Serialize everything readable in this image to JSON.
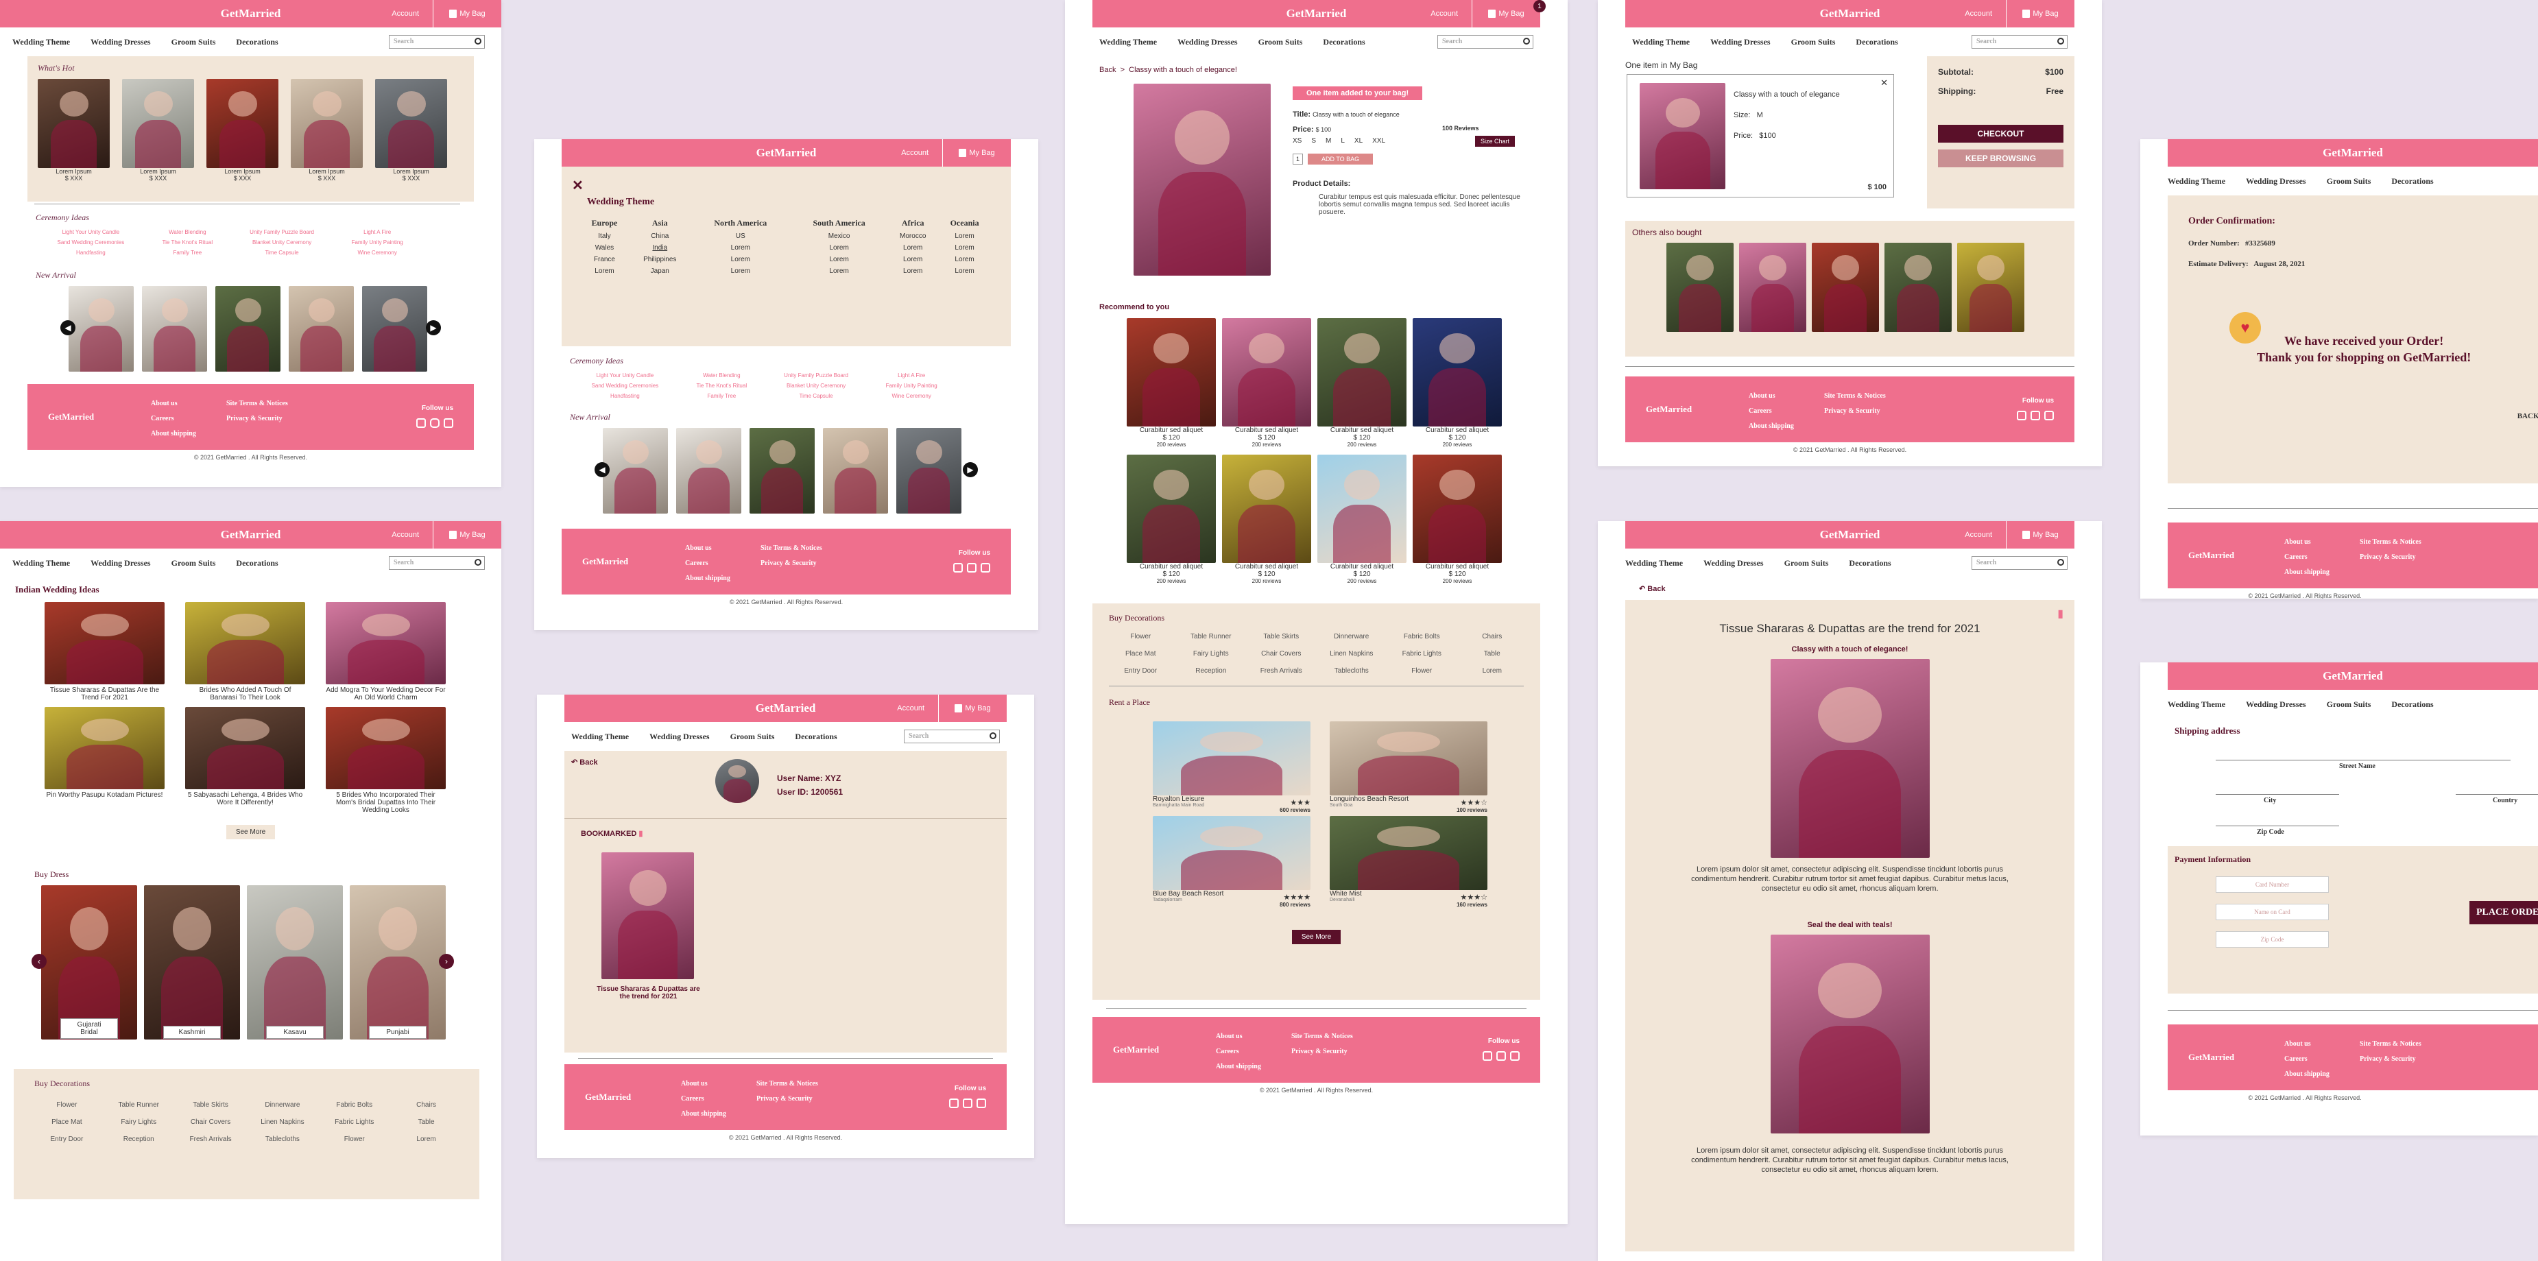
{
  "brand": "GetMarried",
  "account": "Account",
  "my_bag": "My Bag",
  "bag_count": "1",
  "nav": [
    "Wedding Theme",
    "Wedding Dresses",
    "Groom Suits",
    "Decorations"
  ],
  "search_placeholder": "Search",
  "footer": {
    "about": "About us",
    "careers": "Careers",
    "shipping": "About shipping",
    "terms": "Site Terms & Notices",
    "privacy": "Privacy & Security",
    "follow": "Follow us",
    "copyright": "© 2021 GetMarried . All Rights Reserved."
  },
  "home": {
    "whats_hot": "What's Hot",
    "hot_items": [
      {
        "name": "Lorem Ipsum",
        "price": "$ XXX"
      },
      {
        "name": "Lorem Ipsum",
        "price": "$ XXX"
      },
      {
        "name": "Lorem Ipsum",
        "price": "$ XXX"
      },
      {
        "name": "Lorem Ipsum",
        "price": "$ XXX"
      },
      {
        "name": "Lorem Ipsum",
        "price": "$ XXX"
      }
    ],
    "ceremony_ideas": "Ceremony Ideas",
    "ideas": [
      [
        "Light Your Unity Candle",
        "Water Blending",
        "Unity Family Puzzle Board",
        "Light A Fire"
      ],
      [
        "Sand Wedding Ceremonies",
        "Tie The Knot's Ritual",
        "Blanket Unity Ceremony",
        "Family Unity Painting"
      ],
      [
        "Handfasting",
        "Family Tree",
        "Time Capsule",
        "Wine Ceremony"
      ]
    ],
    "new_arrival": "New Arrival"
  },
  "theme": {
    "title": "Wedding Theme",
    "regions": [
      "Europe",
      "Asia",
      "North America",
      "South America",
      "Africa",
      "Oceania"
    ],
    "rows": [
      [
        "Italy",
        "China",
        "US",
        "Mexico",
        "Morocco",
        "Lorem"
      ],
      [
        "Wales",
        "India",
        "Lorem",
        "Lorem",
        "Lorem",
        "Lorem"
      ],
      [
        "France",
        "Philippines",
        "Lorem",
        "Lorem",
        "Lorem",
        "Lorem"
      ],
      [
        "Lorem",
        "Japan",
        "Lorem",
        "Lorem",
        "Lorem",
        "Lorem"
      ]
    ]
  },
  "ideas_page": {
    "title": "Indian Wedding Ideas",
    "articles": [
      "Tissue Shararas & Dupattas Are the Trend For 2021",
      "Brides Who Added A Touch Of Banarasi To Their Look",
      "Add Mogra To Your Wedding Decor For An Old World Charm",
      "Pin Worthy Pasupu Kotadam Pictures!",
      "5 Sabyasachi Lehenga, 4 Brides Who Wore It Differently!",
      "5 Brides Who Incorporated Their Mom's Bridal Dupattas Into Their Wedding Looks"
    ],
    "see_more": "See More",
    "buy_dress": "Buy Dress",
    "dresses": [
      "Gujarati Bridal",
      "Kashmiri",
      "Kasavu",
      "Punjabi"
    ],
    "buy_decorations": "Buy Decorations",
    "decor": [
      "Flower",
      "Table Runner",
      "Table Skirts",
      "Dinnerware",
      "Fabric Bolts",
      "Chairs",
      "Place Mat",
      "Fairy Lights",
      "Chair Covers",
      "Linen Napkins",
      "Fabric Lights",
      "Table",
      "Entry Door",
      "Reception",
      "Fresh Arrivals",
      "Tablecloths",
      "Flower",
      "Lorem"
    ]
  },
  "profile": {
    "back": "Back",
    "user_name_label": "User Name:",
    "user_name": "XYZ",
    "user_id_label": "User ID:",
    "user_id": "1200561",
    "bookmarked": "BOOKMARKED",
    "article": "Tissue Shararas & Dupattas are the trend for 2021"
  },
  "product": {
    "back": "Back",
    "crumb": "Classy with a touch of elegance!",
    "added": "One item added to your bag!",
    "title_label": "Title:",
    "title": "Classy with a touch of elegance",
    "price_label": "Price:",
    "price": "$ 100",
    "reviews": "100 Reviews",
    "sizes": [
      "XS",
      "S",
      "M",
      "L",
      "XL",
      "XXL"
    ],
    "size_chart": "Size Chart",
    "qty": "1",
    "add": "ADD TO BAG",
    "details_label": "Product Details:",
    "details": "Curabitur tempus est quis malesuada efficitur. Donec pellentesque lobortis semut convallis magna tempus sed. Sed laoreet iaculis posuere.",
    "recommend": "Recommend to you",
    "rec_items": [
      {
        "name": "Curabitur sed aliquet",
        "price": "$ 120",
        "reviews": "200 reviews"
      },
      {
        "name": "Curabitur sed aliquet",
        "price": "$ 120",
        "reviews": "200 reviews"
      },
      {
        "name": "Curabitur sed aliquet",
        "price": "$ 120",
        "reviews": "200 reviews"
      },
      {
        "name": "Curabitur sed aliquet",
        "price": "$ 120",
        "reviews": "200 reviews"
      },
      {
        "name": "Curabitur sed aliquet",
        "price": "$ 120",
        "reviews": "200 reviews"
      },
      {
        "name": "Curabitur sed aliquet",
        "price": "$ 120",
        "reviews": "200 reviews"
      },
      {
        "name": "Curabitur sed aliquet",
        "price": "$ 120",
        "reviews": "200 reviews"
      },
      {
        "name": "Curabitur sed aliquet",
        "price": "$ 120",
        "reviews": "200 reviews"
      }
    ],
    "buy_decorations": "Buy Decorations",
    "rent": "Rent a Place",
    "places": [
      {
        "name": "Royalton Leisure",
        "loc": "Bamnighatta Main Road",
        "stars": "★★★",
        "reviews": "600 reviews"
      },
      {
        "name": "Longuinhos Beach Resort",
        "loc": "South Goa",
        "stars": "★★★☆",
        "reviews": "100 reviews"
      },
      {
        "name": "Blue Bay Beach Resort",
        "loc": "Tadaqalorram",
        "stars": "★★★★",
        "reviews": "800 reviews"
      },
      {
        "name": "White Mist",
        "loc": "Devanahalli",
        "stars": "★★★☆",
        "reviews": "160 reviews"
      }
    ],
    "see_more": "See More"
  },
  "bag": {
    "count": "One item in My Bag",
    "item": "Classy with a touch of elegance",
    "size_label": "Size:",
    "size": "M",
    "price_label": "Price:",
    "price": "$100",
    "total": "$ 100",
    "subtotal_label": "Subtotal:",
    "subtotal": "$100",
    "shipping_label": "Shipping:",
    "shipping": "Free",
    "checkout": "CHECKOUT",
    "keep": "KEEP BROWSING",
    "others": "Others also bought"
  },
  "article": {
    "back": "Back",
    "title": "Tissue Shararas & Dupattas are the trend for 2021",
    "sub1": "Classy with a touch of elegance!",
    "body": "Lorem ipsum dolor sit amet, consectetur adipiscing elit. Suspendisse tincidunt lobortis purus condimentum hendrerit. Curabitur rutrum tortor sit amet feugiat dapibus. Curabitur metus lacus, consectetur eu odio sit amet, rhoncus aliquam lorem.",
    "sub2": "Seal the deal with teals!"
  },
  "order": {
    "title": "Order Confirmation:",
    "num_label": "Order Number:",
    "num": "#3325689",
    "del_label": "Estimate Delivery:",
    "del": "August 28, 2021",
    "msg1": "We have received your Order!",
    "msg2": "Thank you for shopping on GetMarried!",
    "back": "BACK TO HOM"
  },
  "shipping": {
    "title": "Shipping address",
    "street": "Street Name",
    "city": "City",
    "country": "Country",
    "zip": "Zip Code",
    "payment": "Payment Information",
    "card": "Card Number",
    "name": "Name on Card",
    "pzip": "Zip Code",
    "place": "PLACE ORDE"
  }
}
